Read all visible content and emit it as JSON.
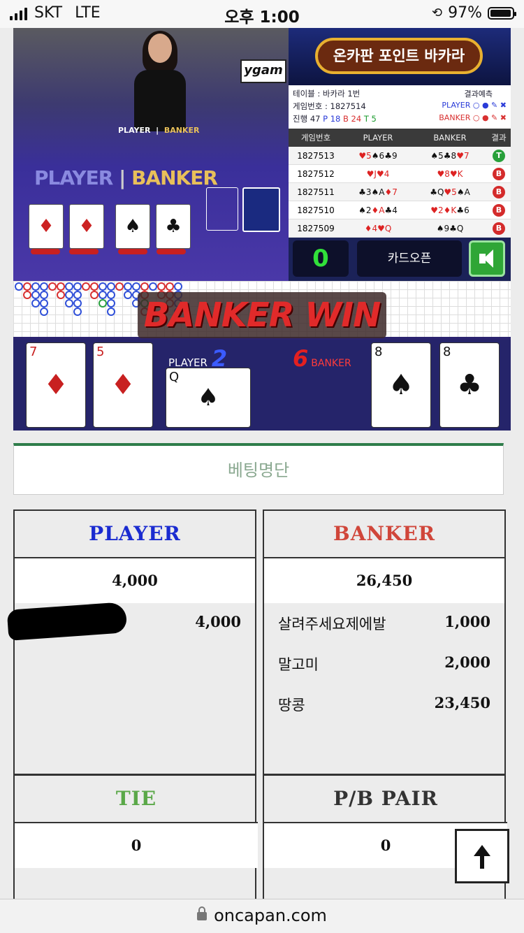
{
  "status_bar": {
    "carrier": "SKT",
    "network": "LTE",
    "time": "오후 1:00",
    "battery": "97%",
    "battery_level": 0.97
  },
  "game": {
    "video_logo": "ygam",
    "table_player_label": "PLAYER",
    "table_banker_label": "BANKER",
    "big_player": "PLAYER",
    "big_banker": "BANKER",
    "banner_title": "온카판 포인트 바카라",
    "info": {
      "table": "테이블 : 바카라 1번",
      "game_no": "게임번호 : 1827514",
      "progress_label": "진행 47",
      "p_count": "P 18",
      "b_count": "B 24",
      "t_count": "T 5",
      "prediction_label": "결과예측",
      "pred_player": "PLAYER",
      "pred_banker": "BANKER"
    },
    "history": {
      "headers": [
        "게임번호",
        "PLAYER",
        "BANKER",
        "결과"
      ],
      "rows": [
        {
          "no": "1827513",
          "player": "♥5♠6♣9",
          "banker": "♠5♣8♥7",
          "result": "T"
        },
        {
          "no": "1827512",
          "player": "♥J♥4",
          "banker": "♥8♥K",
          "result": "B"
        },
        {
          "no": "1827511",
          "player": "♣3♠A♦7",
          "banker": "♣Q♥5♠A",
          "result": "B"
        },
        {
          "no": "1827510",
          "player": "♠2♦A♣4",
          "banker": "♥2♦K♣6",
          "result": "B"
        },
        {
          "no": "1827509",
          "player": "♦4♥Q",
          "banker": "♠9♣Q",
          "result": "B"
        }
      ]
    },
    "counter": "0",
    "card_open": "카드오픈",
    "win_text": "BANKER WIN",
    "player_label": "PLAYER",
    "player_score": "2",
    "banker_label": "BANKER",
    "banker_score": "6",
    "player_cards": [
      "7",
      "5",
      "Q"
    ],
    "banker_cards": [
      "8",
      "8"
    ]
  },
  "betting": {
    "header": "베팅명단",
    "player": {
      "title": "PLAYER",
      "total": "4,000",
      "entries": [
        {
          "name": "",
          "amount": "4,000"
        }
      ]
    },
    "banker": {
      "title": "BANKER",
      "total": "26,450",
      "entries": [
        {
          "name": "살려주세요제에발",
          "amount": "1,000"
        },
        {
          "name": "말고미",
          "amount": "2,000"
        },
        {
          "name": "땅콩",
          "amount": "23,450"
        }
      ]
    },
    "tie": {
      "title": "TIE",
      "total": "0"
    },
    "pair": {
      "title": "P/B PAIR",
      "total": "0"
    }
  },
  "colors": {
    "player": "#1a2bd0",
    "banker": "#d0463a",
    "tie": "#5aa848",
    "pair": "#333333"
  },
  "url": "oncapan.com"
}
